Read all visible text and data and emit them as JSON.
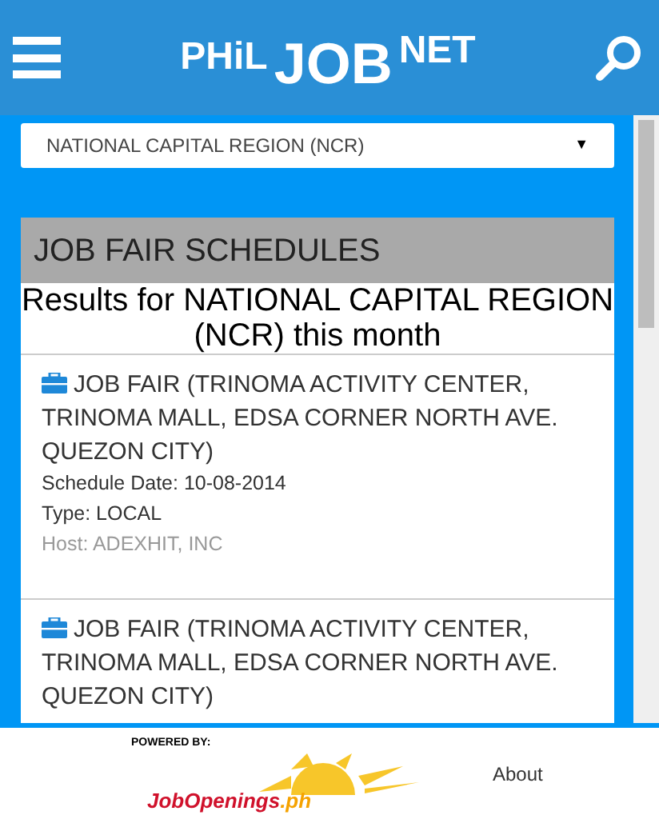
{
  "header": {
    "logo": [
      "PHiL",
      "JOB",
      "NET"
    ]
  },
  "region_select": {
    "value": "NATIONAL CAPITAL REGION (NCR)",
    "arrow": "▼"
  },
  "section": {
    "title": "JOB FAIR SCHEDULES",
    "results": "Results for NATIONAL CAPITAL REGION (NCR) this month"
  },
  "job_fairs": [
    {
      "title": "JOB FAIR (TRINOMA ACTIVITY CENTER, TRINOMA MALL, EDSA CORNER NORTH AVE. QUEZON CITY)",
      "date": "Schedule Date: 10-08-2014",
      "type": "Type: LOCAL",
      "host": "Host: ADEXHIT, INC"
    },
    {
      "title": "JOB FAIR (TRINOMA ACTIVITY CENTER, TRINOMA MALL, EDSA CORNER NORTH AVE. QUEZON CITY)"
    }
  ],
  "footer": {
    "powered_by": "POWERED BY:",
    "logo": [
      "JobOpenings",
      ".ph"
    ],
    "link": "About"
  }
}
